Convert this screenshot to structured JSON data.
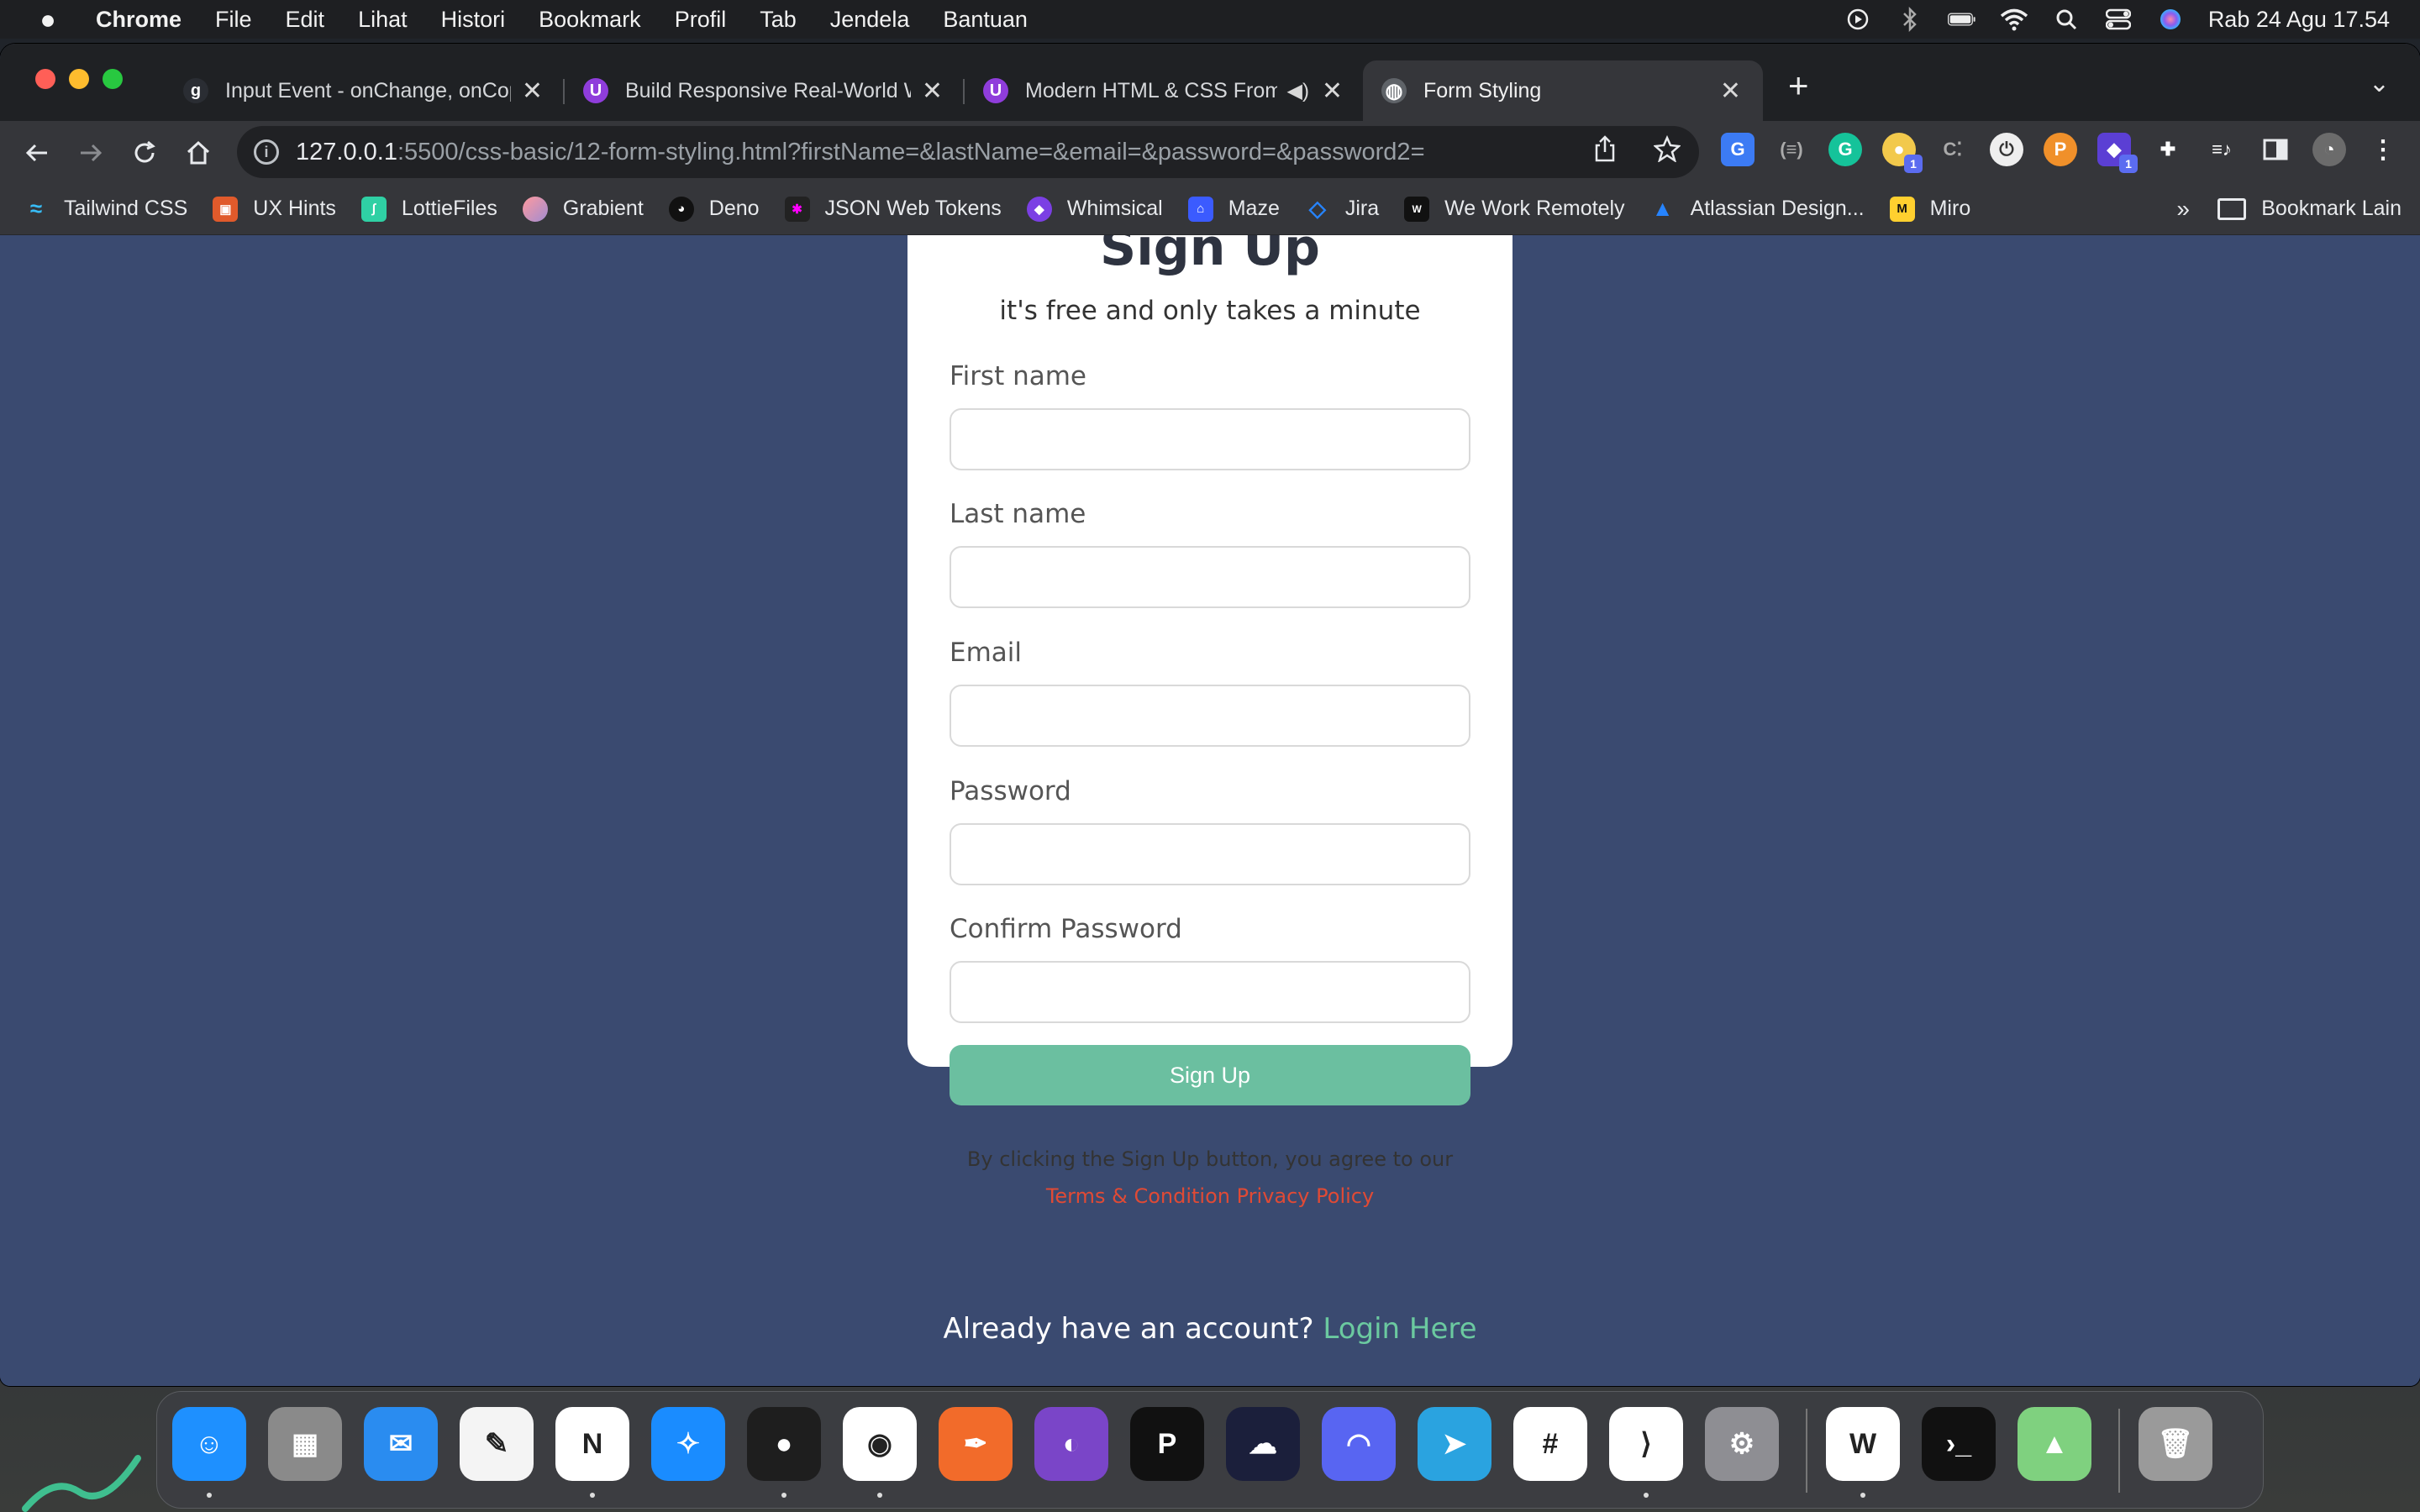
{
  "menubar": {
    "app_name": "Chrome",
    "items": [
      "File",
      "Edit",
      "Lihat",
      "Histori",
      "Bookmark",
      "Profil",
      "Tab",
      "Jendela",
      "Bantuan"
    ],
    "clock": "Rab 24 Agu  17.54"
  },
  "tabs": [
    {
      "title": "Input Event - onChange, onCopy",
      "favicon": "g-favicon",
      "favicon_text": "g",
      "active": false
    },
    {
      "title": "Build Responsive Real-World Websites",
      "favicon": "udemy-favicon",
      "favicon_text": "U",
      "active": false
    },
    {
      "title": "Modern HTML & CSS From",
      "favicon": "udemy-favicon",
      "favicon_text": "U",
      "active": false
    },
    {
      "title": "Form Styling",
      "favicon": "globe-favicon",
      "favicon_text": "◍",
      "active": true
    }
  ],
  "address_bar": {
    "host": "127.0.0.1",
    "rest": ":5500/css-basic/12-form-styling.html?firstName=&lastName=&email=&password=&password2="
  },
  "bookmarks": [
    {
      "label": "Tailwind CSS",
      "color": "#38bdf8",
      "glyph": "≈"
    },
    {
      "label": "UX Hints",
      "color": "#e05a2b",
      "glyph": "▣"
    },
    {
      "label": "LottieFiles",
      "color": "#2fd0a4",
      "glyph": "∫"
    },
    {
      "label": "Grabient",
      "color": "#c77dff",
      "glyph": "●"
    },
    {
      "label": "Deno",
      "color": "#111111",
      "glyph": "◕"
    },
    {
      "label": "JSON Web Tokens",
      "color": "#222222",
      "glyph": "✱"
    },
    {
      "label": "Whimsical",
      "color": "#7b3fe4",
      "glyph": "◆"
    },
    {
      "label": "Maze",
      "color": "#3b5bff",
      "glyph": "⌂"
    },
    {
      "label": "Jira",
      "color": "#2684ff",
      "glyph": "◇"
    },
    {
      "label": "We Work Remotely",
      "color": "#111111",
      "glyph": "W"
    },
    {
      "label": "Atlassian Design...",
      "color": "#2684ff",
      "glyph": "▲"
    },
    {
      "label": "Miro",
      "color": "#ffd02f",
      "glyph": "M"
    }
  ],
  "bookmarks_more": "»",
  "bookmarks_folder": "Bookmark Lain",
  "form": {
    "title": "Sign Up",
    "subtitle": "it's free and only takes a minute",
    "fields": [
      {
        "label": "First name",
        "value": ""
      },
      {
        "label": "Last name",
        "value": ""
      },
      {
        "label": "Email",
        "value": ""
      },
      {
        "label": "Password",
        "value": ""
      },
      {
        "label": "Confirm Password",
        "value": ""
      }
    ],
    "submit_label": "Sign Up",
    "legal_prefix": "By clicking the Sign Up button, you agree to our ",
    "legal_link": "Terms & Condition Privacy Policy",
    "already_text": "Already have an account? ",
    "login_link": "Login Here"
  },
  "colors": {
    "page_background": "#3a4a70",
    "button": "#6bbfa0",
    "legal_link": "#e04a35",
    "login_link": "#6bc9a0"
  },
  "dock_apps": [
    {
      "name": "finder-icon",
      "color": "#1e90ff",
      "glyph": "☺"
    },
    {
      "name": "launchpad-icon",
      "color": "#8a8a8a",
      "glyph": "▦"
    },
    {
      "name": "mail-icon",
      "color": "#2a8cf0",
      "glyph": "✉"
    },
    {
      "name": "textedit-icon",
      "color": "#f4f4f4",
      "glyph": "✎"
    },
    {
      "name": "notion-icon",
      "color": "#ffffff",
      "glyph": "N"
    },
    {
      "name": "safari-icon",
      "color": "#1a8cff",
      "glyph": "✧"
    },
    {
      "name": "figma-icon",
      "color": "#1e1e1e",
      "glyph": "●"
    },
    {
      "name": "chrome-icon",
      "color": "#ffffff",
      "glyph": "◉"
    },
    {
      "name": "pen-app-icon",
      "color": "#f26b2a",
      "glyph": "✒"
    },
    {
      "name": "github-desktop-icon",
      "color": "#7a45c8",
      "glyph": "◐"
    },
    {
      "name": "pitch-icon",
      "color": "#111111",
      "glyph": "P"
    },
    {
      "name": "cloud-terminal-icon",
      "color": "#1b1f3b",
      "glyph": "☁"
    },
    {
      "name": "discord-icon",
      "color": "#5865f2",
      "glyph": "◠"
    },
    {
      "name": "telegram-icon",
      "color": "#2aa3e0",
      "glyph": "➤"
    },
    {
      "name": "slack-icon",
      "color": "#ffffff",
      "glyph": "#"
    },
    {
      "name": "vscode-icon",
      "color": "#ffffff",
      "glyph": "⟩"
    },
    {
      "name": "system-settings-icon",
      "color": "#8e8e93",
      "glyph": "⚙"
    },
    {
      "name": "wps-office-icon",
      "color": "#ffffff",
      "glyph": "W"
    },
    {
      "name": "terminal-icon",
      "color": "#111111",
      "glyph": "›_"
    },
    {
      "name": "maps-icon",
      "color": "#7fd17f",
      "glyph": "▲"
    },
    {
      "name": "trash-icon",
      "color": "#9a9a9a",
      "glyph": "🗑"
    }
  ]
}
